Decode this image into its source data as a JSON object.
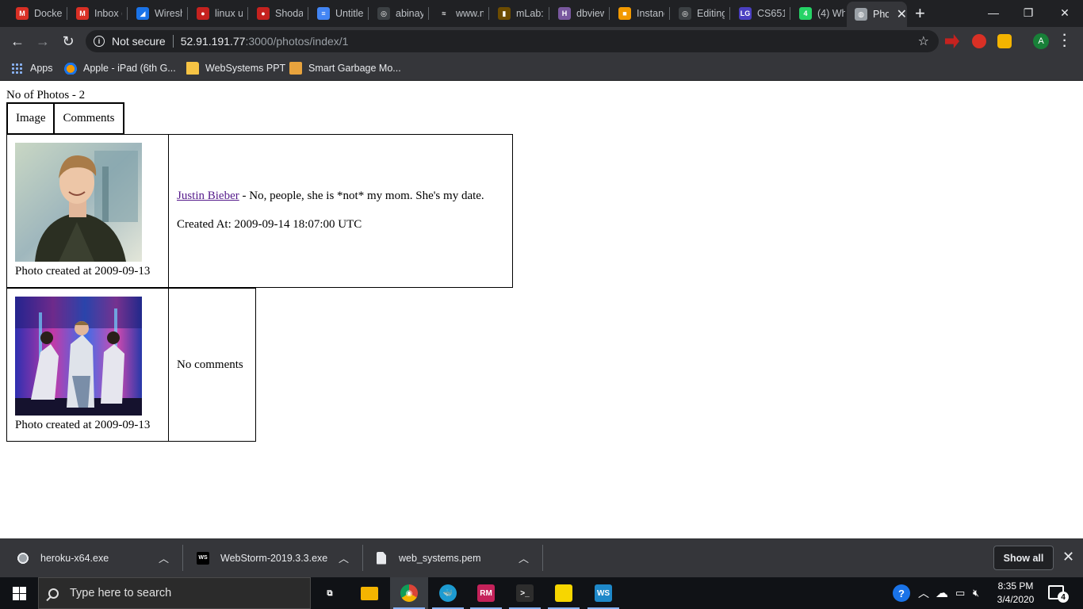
{
  "browser": {
    "tabs": [
      {
        "title": "Docke",
        "icon": "gmail-icon",
        "color": "#d93025",
        "glyph": "M"
      },
      {
        "title": "Inbox (",
        "icon": "gmail-icon",
        "color": "#d93025",
        "glyph": "M"
      },
      {
        "title": "Wiresh",
        "icon": "wireshark-icon",
        "color": "#1a73e8",
        "glyph": "◢"
      },
      {
        "title": "linux u",
        "icon": "shodan-icon",
        "color": "#c5221f",
        "glyph": "●"
      },
      {
        "title": "Shodan",
        "icon": "shodan-icon",
        "color": "#c5221f",
        "glyph": "●"
      },
      {
        "title": "Untitle",
        "icon": "google-docs-icon",
        "color": "#4285f4",
        "glyph": "≡"
      },
      {
        "title": "abinay",
        "icon": "github-icon",
        "color": "#3c4043",
        "glyph": "◎"
      },
      {
        "title": "www.n",
        "icon": "npm-icon",
        "color": "#202124",
        "glyph": "≈"
      },
      {
        "title": "mLab:",
        "icon": "mlab-icon",
        "color": "#6d4c00",
        "glyph": "▮"
      },
      {
        "title": "dbview",
        "icon": "heroku-icon",
        "color": "#79589f",
        "glyph": "H"
      },
      {
        "title": "Instanc",
        "icon": "aws-icon",
        "color": "#f29900",
        "glyph": "■"
      },
      {
        "title": "Editing",
        "icon": "github-icon",
        "color": "#3c4043",
        "glyph": "◎"
      },
      {
        "title": "CS651",
        "icon": "lg-icon",
        "color": "#4a3fc1",
        "glyph": "LG"
      },
      {
        "title": "(4) Wh",
        "icon": "whatsapp-icon",
        "color": "#25d366",
        "glyph": "4"
      },
      {
        "title": "Phot",
        "icon": "globe-icon",
        "color": "#9aa0a6",
        "glyph": "◍"
      }
    ],
    "new_tab_label": "+",
    "window_buttons": [
      "—",
      "❐",
      "✕"
    ],
    "security_label": "Not secure",
    "url_host": "52.91.191.77",
    "url_rest": ":3000/photos/index/1",
    "profile_initial": "A",
    "bookmarks": [
      {
        "label": "Apps",
        "icon": "apps-grid-icon"
      },
      {
        "label": "Apple - iPad (6th G...",
        "icon": "apple-icon"
      },
      {
        "label": "WebSystems PPT",
        "icon": "folder-icon"
      },
      {
        "label": "Smart Garbage Mo...",
        "icon": "bookmark-site-icon"
      }
    ]
  },
  "page": {
    "photo_count": "No of Photos - 2",
    "headers": {
      "image": "Image",
      "comments": "Comments"
    },
    "photos": [
      {
        "caption": "Photo created at 2009-09-13",
        "comment_author": "Justin Bieber",
        "comment_text": " - No, people, she is *not* my mom. She's my date.",
        "created_at": "Created At: 2009-09-14 18:07:00 UTC"
      },
      {
        "caption": "Photo created at 2009-09-13",
        "no_comments": "No comments"
      }
    ]
  },
  "downloads": {
    "items": [
      {
        "name": "heroku-x64.exe",
        "icon": "installer-icon"
      },
      {
        "name": "WebStorm-2019.3.3.exe",
        "icon": "webstorm-icon"
      },
      {
        "name": "web_systems.pem",
        "icon": "file-icon"
      }
    ],
    "show_all": "Show all"
  },
  "taskbar": {
    "search_placeholder": "Type here to search",
    "apps": [
      {
        "name": "task-view-icon",
        "glyph": "⧉",
        "color": "transparent"
      },
      {
        "name": "file-explorer-icon",
        "glyph": "",
        "color": "#f4b400"
      },
      {
        "name": "chrome-icon",
        "glyph": "◉",
        "color": "#db4437"
      },
      {
        "name": "docker-icon",
        "glyph": "🐳",
        "color": "#1d9bd1"
      },
      {
        "name": "rubymine-icon",
        "glyph": "RM",
        "color": "#c5225a"
      },
      {
        "name": "terminal-icon",
        "glyph": ">_",
        "color": "#2d2d2d"
      },
      {
        "name": "sticky-notes-icon",
        "glyph": "",
        "color": "#f7d600"
      },
      {
        "name": "webstorm-icon",
        "glyph": "WS",
        "color": "#1e88c9"
      }
    ],
    "time": "8:35 PM",
    "date": "3/4/2020",
    "notification_count": "4"
  }
}
